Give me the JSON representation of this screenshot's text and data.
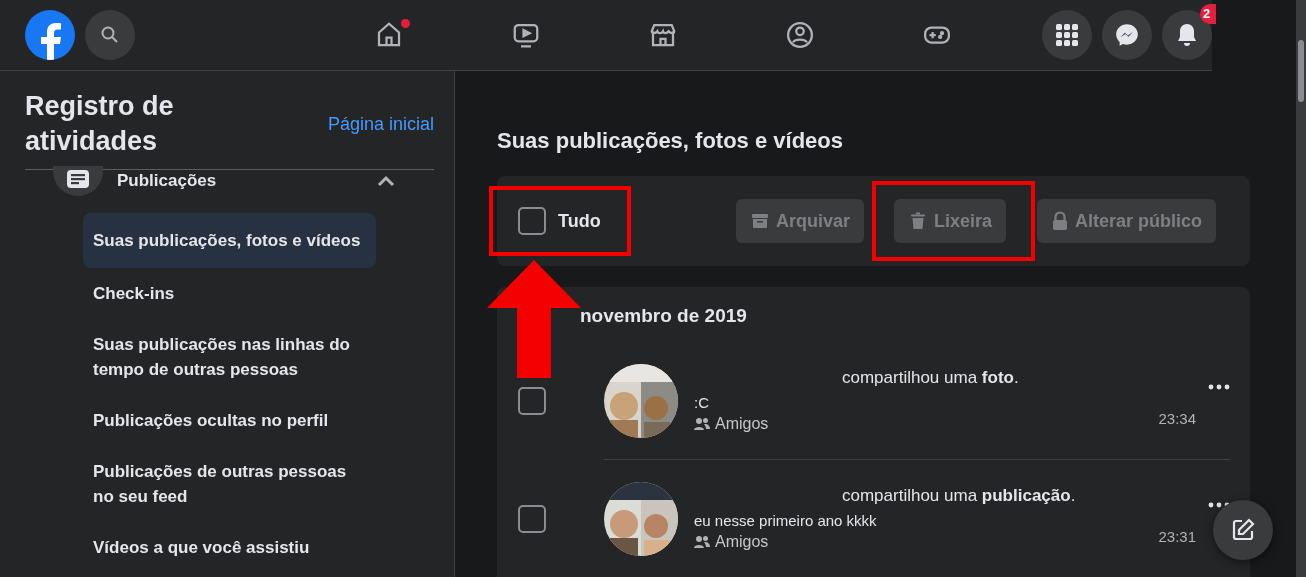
{
  "top_bar": {
    "nav": [
      {
        "kind": "home",
        "dot": true
      },
      {
        "kind": "watch",
        "dot": false
      },
      {
        "kind": "marketplace",
        "dot": false
      },
      {
        "kind": "groups",
        "dot": false
      },
      {
        "kind": "gaming",
        "dot": false
      }
    ],
    "actions": [
      {
        "kind": "menu"
      },
      {
        "kind": "messenger"
      },
      {
        "kind": "notifications",
        "badge": "2"
      }
    ]
  },
  "sidebar": {
    "title": "Registro de atividades",
    "home_link": "Página inicial",
    "section": {
      "label": "Publicações",
      "expanded": true
    },
    "items": [
      {
        "label": "Suas publicações, fotos e vídeos",
        "selected": true
      },
      {
        "label": "Check-ins",
        "selected": false
      },
      {
        "label": "Suas publicações nas linhas do tempo de outras pessoas",
        "selected": false
      },
      {
        "label": "Publicações ocultas no perfil",
        "selected": false
      },
      {
        "label": "Publicações de outras pessoas no seu feed",
        "selected": false
      },
      {
        "label": "Vídeos a que você assistiu",
        "selected": false
      }
    ]
  },
  "main": {
    "heading": "Suas publicações, fotos e vídeos",
    "select_all": {
      "label": "Tudo",
      "checked": false,
      "highlighted": true,
      "pointer": true
    },
    "actions": [
      {
        "kind": "archive",
        "label": "Arquivar",
        "disabled": true,
        "highlighted": false
      },
      {
        "kind": "trash",
        "label": "Lixeira",
        "disabled": true,
        "highlighted": true
      },
      {
        "kind": "lock",
        "label": "Alterar público",
        "disabled": true,
        "highlighted": false
      }
    ],
    "date_heading": "novembro de 2019",
    "posts": [
      {
        "action": "compartilhou uma **foto**.",
        "caption": ":C",
        "audience": "Amigos",
        "time": "23:34",
        "checked": false
      },
      {
        "action": "compartilhou uma **publicação**.",
        "caption": "eu nesse primeiro ano kkkk",
        "audience": "Amigos",
        "time": "23:31",
        "checked": false
      }
    ]
  }
}
